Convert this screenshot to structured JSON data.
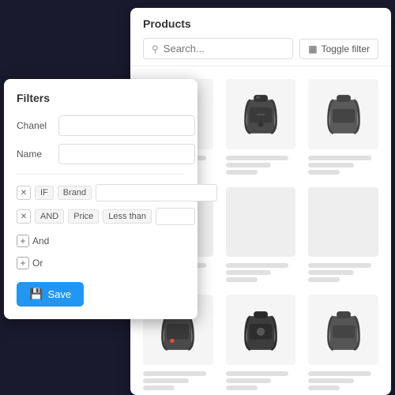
{
  "products_panel": {
    "title": "Products",
    "search_placeholder": "Search...",
    "toggle_filter_label": "Toggle filter",
    "products": [
      {
        "id": 1,
        "has_image": true,
        "row": 1
      },
      {
        "id": 2,
        "has_image": true,
        "row": 1
      },
      {
        "id": 3,
        "has_image": true,
        "row": 1
      },
      {
        "id": 4,
        "has_image": false,
        "row": 2
      },
      {
        "id": 5,
        "has_image": false,
        "row": 2
      },
      {
        "id": 6,
        "has_image": false,
        "row": 2
      },
      {
        "id": 7,
        "has_image": true,
        "row": 3
      },
      {
        "id": 8,
        "has_image": true,
        "row": 3
      },
      {
        "id": 9,
        "has_image": true,
        "row": 3
      }
    ]
  },
  "filters_panel": {
    "title": "Filters",
    "fields": [
      {
        "label": "Chanel",
        "value": ""
      },
      {
        "label": "Name",
        "value": ""
      }
    ],
    "rules": [
      {
        "connector": "IF",
        "field": "Brand",
        "operator": "",
        "value": ""
      },
      {
        "connector": "AND",
        "field": "Price",
        "operator": "Less than",
        "value": ""
      }
    ],
    "add_and_label": "And",
    "add_or_label": "Or",
    "save_label": "Save"
  }
}
